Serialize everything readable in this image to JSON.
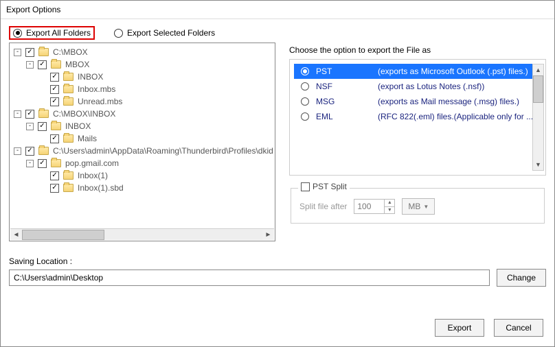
{
  "window": {
    "title": "Export Options"
  },
  "radios": {
    "all_label": "Export All Folders",
    "sel_label": "Export Selected Folders",
    "selected": "all"
  },
  "tree": {
    "rows": [
      {
        "indent": 0,
        "toggle": "-",
        "label": "C:\\MBOX"
      },
      {
        "indent": 1,
        "toggle": "-",
        "label": "MBOX"
      },
      {
        "indent": 2,
        "toggle": "",
        "label": "INBOX"
      },
      {
        "indent": 2,
        "toggle": "",
        "label": "Inbox.mbs"
      },
      {
        "indent": 2,
        "toggle": "",
        "label": "Unread.mbs"
      },
      {
        "indent": 0,
        "toggle": "-",
        "label": "C:\\MBOX\\INBOX"
      },
      {
        "indent": 1,
        "toggle": "-",
        "label": "INBOX"
      },
      {
        "indent": 2,
        "toggle": "",
        "label": "Mails"
      },
      {
        "indent": 0,
        "toggle": "-",
        "label": "C:\\Users\\admin\\AppData\\Roaming\\Thunderbird\\Profiles\\dkid"
      },
      {
        "indent": 1,
        "toggle": "-",
        "label": "pop.gmail.com"
      },
      {
        "indent": 2,
        "toggle": "",
        "label": "Inbox(1)"
      },
      {
        "indent": 2,
        "toggle": "",
        "label": "Inbox(1).sbd"
      }
    ]
  },
  "formats": {
    "heading": "Choose the option to export the File as",
    "items": [
      {
        "name": "PST",
        "desc": "(exports as Microsoft Outlook (.pst) files.)",
        "selected": true
      },
      {
        "name": "NSF",
        "desc": "(export as Lotus Notes (.nsf))",
        "selected": false
      },
      {
        "name": "MSG",
        "desc": "(exports as Mail message (.msg) files.)",
        "selected": false
      },
      {
        "name": "EML",
        "desc": "(RFC 822(.eml) files.(Applicable only for ...",
        "selected": false
      }
    ]
  },
  "pst_split": {
    "legend": "PST Split",
    "label": "Split file after",
    "value": "100",
    "unit": "MB"
  },
  "saving": {
    "label": "Saving Location :",
    "path": "C:\\Users\\admin\\Desktop",
    "change": "Change"
  },
  "buttons": {
    "export": "Export",
    "cancel": "Cancel"
  }
}
